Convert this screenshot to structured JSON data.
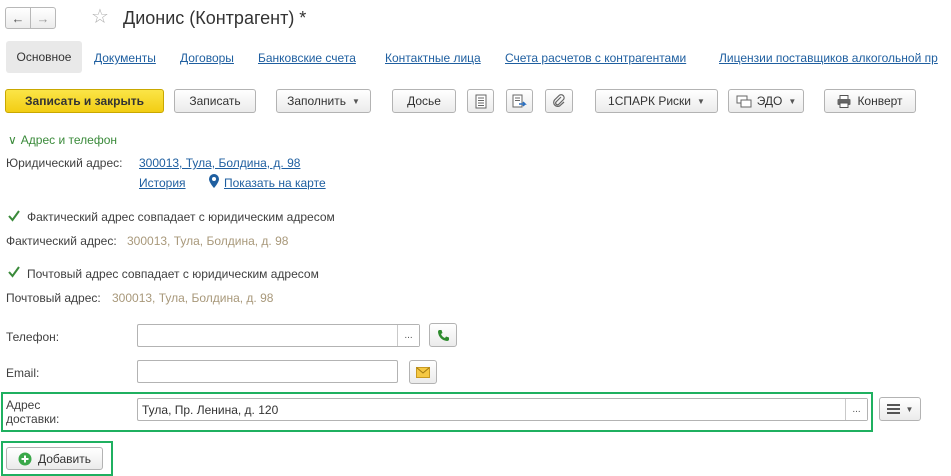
{
  "window": {
    "title": "Дионис (Контрагент) *"
  },
  "tabs": [
    {
      "label": "Основное",
      "active": true
    },
    {
      "label": "Документы"
    },
    {
      "label": "Договоры"
    },
    {
      "label": "Банковские счета"
    },
    {
      "label": "Контактные лица"
    },
    {
      "label": "Счета расчетов с контрагентами"
    },
    {
      "label": "Лицензии поставщиков алкогольной пр"
    }
  ],
  "toolbar": {
    "save_close": "Записать и закрыть",
    "save": "Записать",
    "fill": "Заполнить",
    "dossier": "Досье",
    "spark": "1СПАРК Риски",
    "edo": "ЭДО",
    "konvert": "Конверт"
  },
  "section": {
    "header": "Адрес и телефон"
  },
  "legal_address": {
    "label": "Юридический адрес:",
    "value": "300013, Тула, Болдина, д. 98",
    "history_link": "История",
    "map_link": "Показать на карте"
  },
  "actual_address": {
    "checkbox_label": "Фактический адрес совпадает с юридическим адресом",
    "checked": true,
    "label": "Фактический адрес:",
    "value": "300013, Тула, Болдина, д. 98"
  },
  "postal_address": {
    "checkbox_label": "Почтовый адрес совпадает с юридическим адресом",
    "checked": true,
    "label": "Почтовый адрес:",
    "value": "300013, Тула, Болдина, д. 98"
  },
  "phone": {
    "label": "Телефон:",
    "value": "",
    "dots": "..."
  },
  "email": {
    "label": "Email:",
    "value": ""
  },
  "delivery": {
    "label_line1": "Адрес",
    "label_line2": "доставки:",
    "value": "Тула, Пр. Ленина, д. 120",
    "dots": "..."
  },
  "add_button": {
    "label": "Добавить"
  },
  "colors": {
    "accent_yellow": "#f2cd14",
    "link_blue": "#1f5fa0",
    "section_green": "#3a8a3a",
    "highlight_green": "#1fb060",
    "muted_text": "#a8987a"
  }
}
